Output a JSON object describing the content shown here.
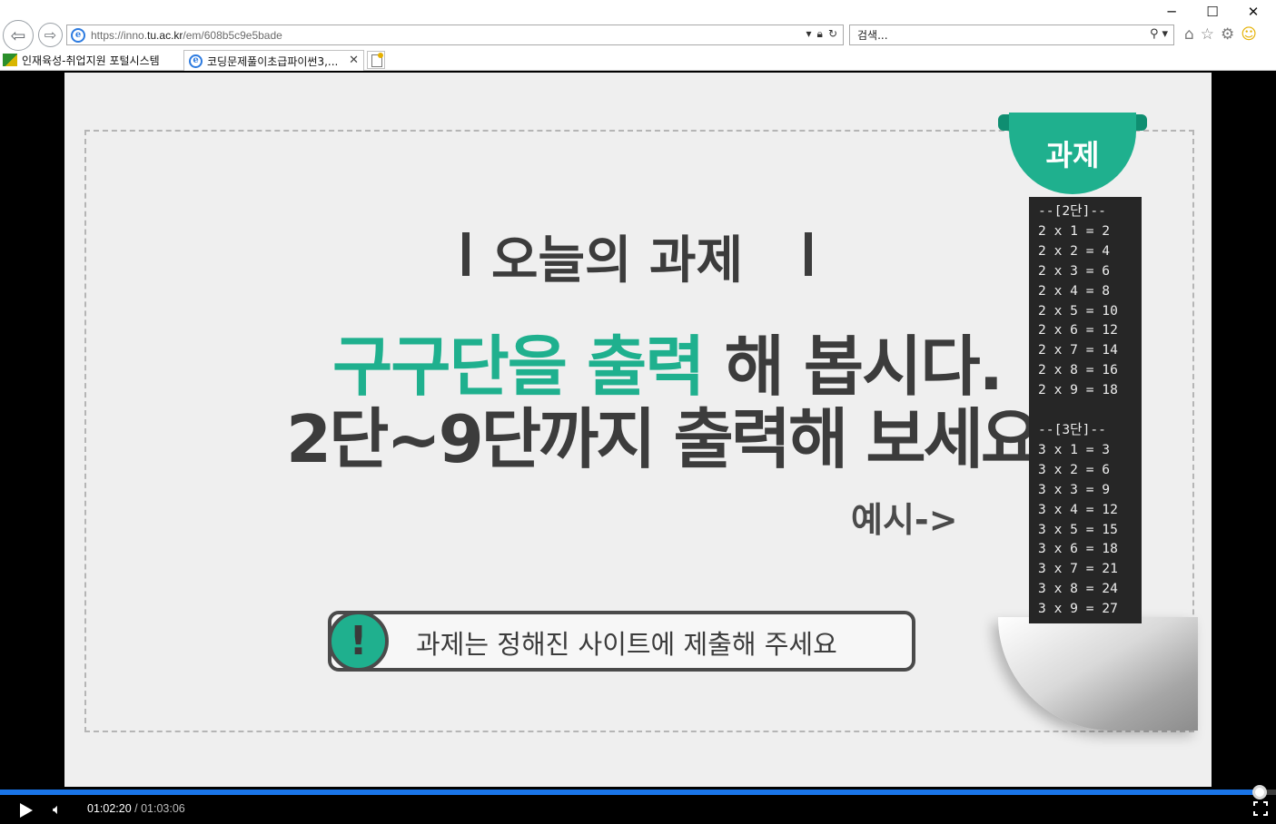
{
  "window": {
    "minimize_glyph": "─",
    "maximize_glyph": "☐",
    "close_glyph": "✕"
  },
  "nav": {
    "back_icon": "arrow-left-icon",
    "forward_icon": "arrow-right-icon",
    "address": {
      "url_prefix": "https://inno.",
      "url_host": "tu.ac.kr",
      "url_path": "/em/608b5c9e5bade"
    },
    "search": {
      "placeholder": "검색..."
    }
  },
  "favorites": {
    "item_label": "인재육성-취업지원 포털시스템"
  },
  "tab": {
    "title": "코딩문제풀이초급파이썬3,...",
    "close_glyph": "✕"
  },
  "slide": {
    "heading": "오늘의 과제",
    "line1_green": "구구단을 출력",
    "line1_gray": " 해 봅시다.",
    "line2": "2단~9단까지 출력해 보세요.",
    "example": "예시->",
    "notice_mark": "!",
    "notice_text": "과제는 정해진 사이트에 제출해 주세요",
    "ribbon_label": "과제",
    "code_lines": [
      "--[2단]--",
      "2 x 1 = 2",
      "2 x 2 = 4",
      "2 x 3 = 6",
      "2 x 4 = 8",
      "2 x 5 = 10",
      "2 x 6 = 12",
      "2 x 7 = 14",
      "2 x 8 = 16",
      "2 x 9 = 18",
      "",
      "--[3단]--",
      "3 x 1 = 3",
      "3 x 2 = 6",
      "3 x 3 = 9",
      "3 x 4 = 12",
      "3 x 5 = 15",
      "3 x 6 = 18",
      "3 x 7 = 21",
      "3 x 8 = 24",
      "3 x 9 = 27"
    ]
  },
  "player": {
    "current_time": "01:02:20",
    "separator": " / ",
    "duration": "01:03:06",
    "progress_fraction": 0.9873,
    "accent_color": "#1a75e8"
  },
  "colors": {
    "brand_green": "#1fb08e",
    "text_dark": "#3c3c3c"
  }
}
